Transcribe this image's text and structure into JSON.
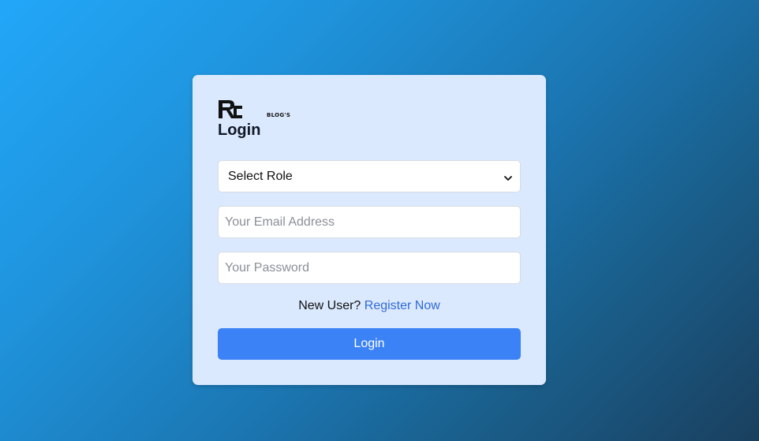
{
  "brand": {
    "logo_text": "RC",
    "sub_text": "BLOG'S"
  },
  "form": {
    "title": "Login",
    "role_select": {
      "selected": "Select Role"
    },
    "email": {
      "placeholder": "Your Email Address",
      "value": ""
    },
    "password": {
      "placeholder": "Your Password",
      "value": ""
    },
    "register_prompt": "New User?",
    "register_link": "Register Now",
    "submit_label": "Login"
  },
  "colors": {
    "card_background": "#dbe9fe",
    "primary_button": "#3b82f6",
    "link": "#2f6ad8",
    "background_start": "#22a7f8",
    "background_end": "#1a3f5e"
  },
  "icons": {
    "select_arrow": "chevron-down-icon",
    "logo": "rc-logo-icon"
  }
}
